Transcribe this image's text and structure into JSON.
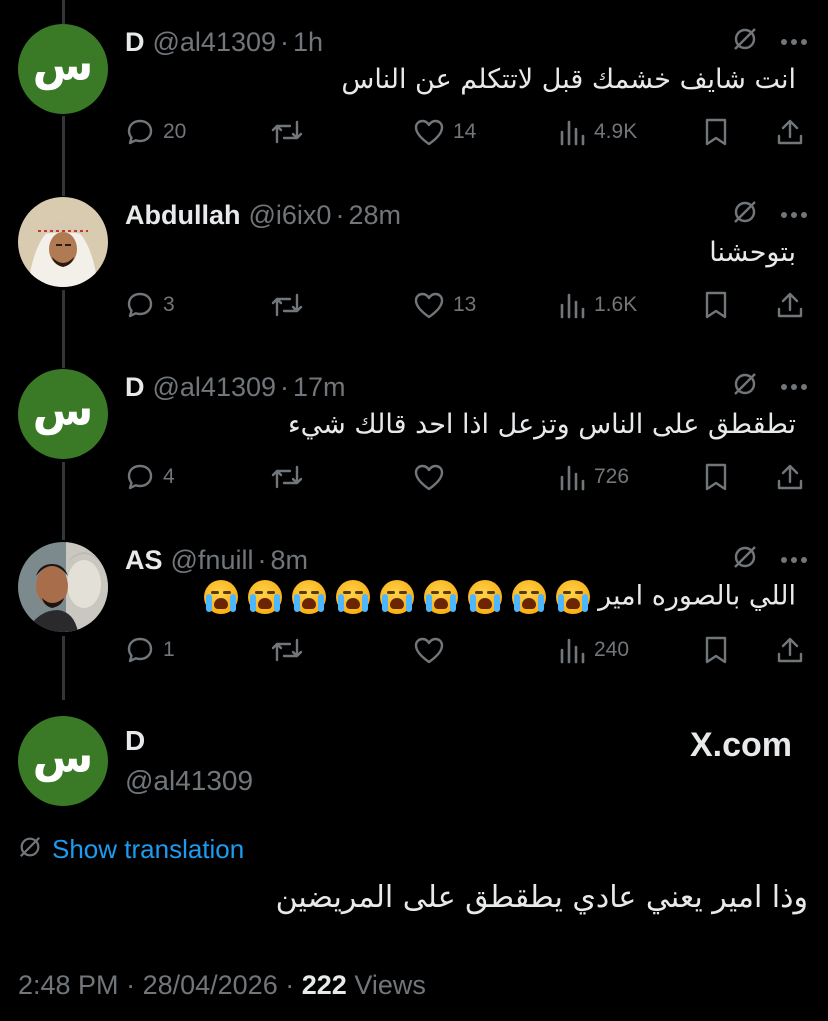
{
  "replies": [
    {
      "avatar_letter": "س",
      "name": "D",
      "handle": "@al41309",
      "time": "1h",
      "text": "انت شايف خشمك قبل لاتتكلم عن الناس",
      "replies": "20",
      "retweets": "",
      "likes": "14",
      "views": "4.9K"
    },
    {
      "avatar_letter": "",
      "name": "Abdullah",
      "handle": "@i6ix0",
      "time": "28m",
      "text": "بتوحشنا",
      "replies": "3",
      "retweets": "",
      "likes": "13",
      "views": "1.6K"
    },
    {
      "avatar_letter": "س",
      "name": "D",
      "handle": "@al41309",
      "time": "17m",
      "text": "تطقطق على الناس وتزعل اذا احد قالك شيء",
      "replies": "4",
      "retweets": "",
      "likes": "",
      "views": "726"
    },
    {
      "avatar_letter": "",
      "name": "AS",
      "handle": "@fnuill",
      "time": "8m",
      "text": "اللي بالصوره امير",
      "emoji_count": 9,
      "emoji_name": "loudly-crying-face",
      "replies": "1",
      "retweets": "",
      "likes": "",
      "views": "240"
    }
  ],
  "main_tweet": {
    "avatar_letter": "س",
    "name": "D",
    "handle": "@al41309",
    "watermark": "X.com",
    "show_translation": "Show translation",
    "text": "وذا امير يعني عادي يطقطق على المريضين",
    "time": "2:48 PM",
    "date": "28/04/2026",
    "views_count": "222",
    "views_label": "Views"
  },
  "colors": {
    "background": "#000000",
    "text": "#e7e9ea",
    "muted": "#71767b",
    "link": "#1d9bf0",
    "avatar_green": "#3a7a26",
    "thread_line": "#333639"
  },
  "icons": [
    "reply-icon",
    "retweet-icon",
    "like-icon",
    "views-icon",
    "bookmark-icon",
    "share-icon",
    "translate-icon",
    "more-icon"
  ]
}
